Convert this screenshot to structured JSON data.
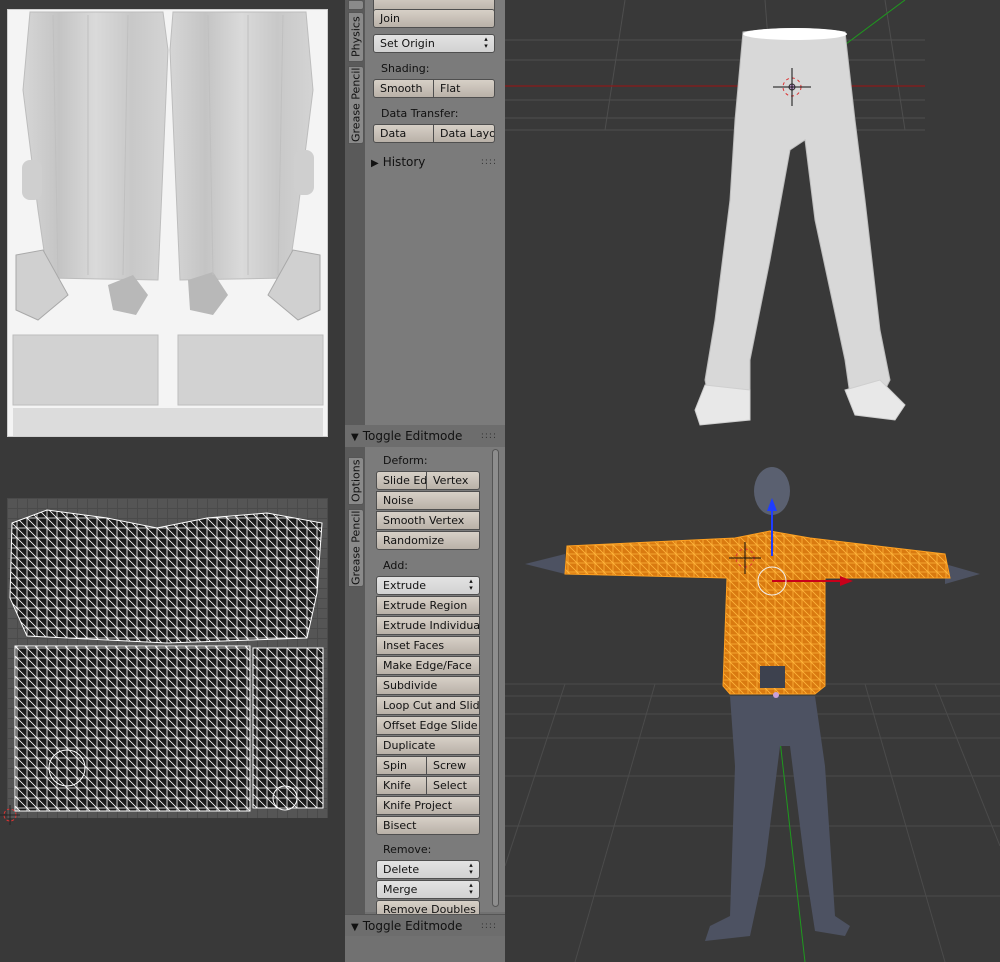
{
  "colors": {
    "viewport_bg": "#393939",
    "shelf_bg": "#7b7b7b",
    "button_bg": "#c8c0b7",
    "mesh_select": "#ff9c1a",
    "axis_x": "#c8001a",
    "axis_y": "#1e9a1e",
    "axis_z": "#1f3dff"
  },
  "tabs_top": [
    "Physics",
    "Grease Pencil"
  ],
  "tabs_bottom": [
    "Options",
    "Grease Pencil"
  ],
  "shelf_top": {
    "join_label": "Join",
    "set_origin_label": "Set Origin",
    "shading_label": "Shading:",
    "smooth_label": "Smooth",
    "flat_label": "Flat",
    "data_transfer_label": "Data Transfer:",
    "data_label": "Data",
    "data_layout_label": "Data Layo",
    "history_label": "History"
  },
  "shelf_bottom": {
    "header_label": "Toggle Editmode",
    "deform_label": "Deform:",
    "slide_edge_label": "Slide Ed",
    "vertex_label": "Vertex",
    "noise_label": "Noise",
    "smooth_vertex_label": "Smooth Vertex",
    "randomize_label": "Randomize",
    "add_label": "Add:",
    "extrude_label": "Extrude",
    "extrude_region_label": "Extrude Region",
    "extrude_individual_label": "Extrude Individual",
    "inset_faces_label": "Inset Faces",
    "make_edge_face_label": "Make Edge/Face",
    "subdivide_label": "Subdivide",
    "loop_cut_label": "Loop Cut and Slide",
    "offset_edge_slide_label": "Offset Edge Slide",
    "duplicate_label": "Duplicate",
    "spin_label": "Spin",
    "screw_label": "Screw",
    "knife_label": "Knife",
    "select_label": "Select",
    "knife_project_label": "Knife Project",
    "bisect_label": "Bisect",
    "remove_label": "Remove:",
    "delete_label": "Delete",
    "merge_label": "Merge",
    "remove_doubles_label": "Remove Doubles",
    "footer_label": "Toggle Editmode"
  },
  "icons": {
    "panel_open": "triangle-down-icon",
    "panel_closed": "triangle-right-icon",
    "grip": "drag-grip-icon",
    "cursor": "3d-cursor-icon"
  }
}
